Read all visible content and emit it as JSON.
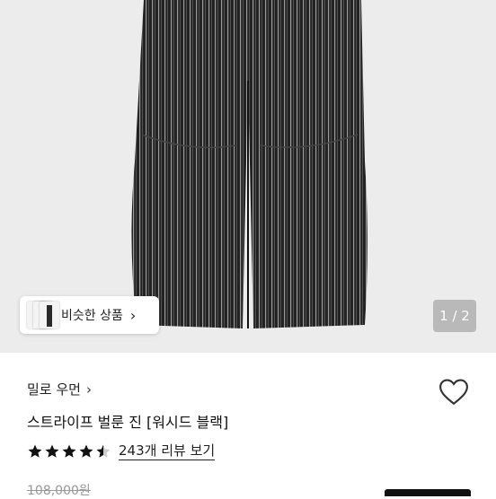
{
  "gallery": {
    "similar_label": "비슷한 상품",
    "similar_chevron": "›",
    "counter": "1 / 2"
  },
  "product": {
    "brand": "밀로 우먼",
    "brand_chevron": "›",
    "title": "스트라이프 벌룬 진 [워시드 블랙]",
    "rating": 4.5,
    "reviews_label": "243개 리뷰 보기",
    "original_price": "108,000원"
  },
  "icons": {
    "heart": "heart-outline-icon",
    "star": "star-icon",
    "chevron": "chevron-right-icon"
  },
  "colors": {
    "gallery_bg": "#ececec",
    "pants": "#222222",
    "stripe": "#8a8a8a"
  }
}
